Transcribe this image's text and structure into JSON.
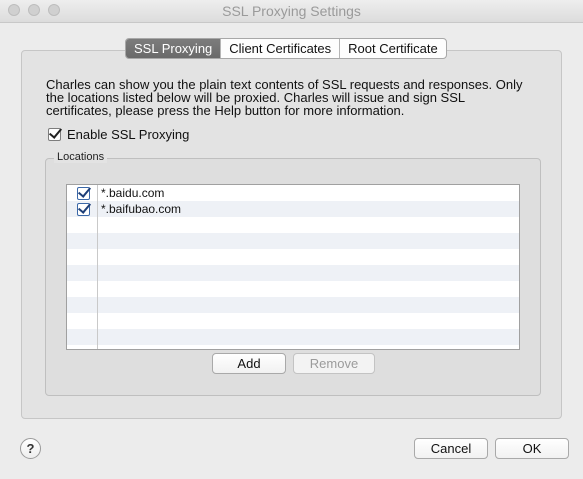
{
  "window": {
    "title": "SSL Proxying Settings"
  },
  "tabs": [
    {
      "label": "SSL Proxying",
      "active": true
    },
    {
      "label": "Client Certificates",
      "active": false
    },
    {
      "label": "Root Certificate",
      "active": false
    }
  ],
  "description": {
    "line1": "Charles can show you the plain text contents of SSL requests and responses. Only",
    "line2": "the locations listed below will be proxied. Charles will issue and sign SSL",
    "line3": "certificates, please press the Help button for more information."
  },
  "enable_ssl": {
    "label": "Enable SSL Proxying",
    "checked": true
  },
  "locations": {
    "group_label": "Locations",
    "items": [
      {
        "host": "*.baidu.com",
        "enabled": true
      },
      {
        "host": "*.baifubao.com",
        "enabled": true
      }
    ],
    "add_label": "Add",
    "remove_label": "Remove"
  },
  "footer": {
    "help_label": "?",
    "cancel_label": "Cancel",
    "ok_label": "OK"
  },
  "colors": {
    "active_tab": "#737373",
    "list_stripe": "#eef1f6",
    "window_bg": "#ececec"
  }
}
